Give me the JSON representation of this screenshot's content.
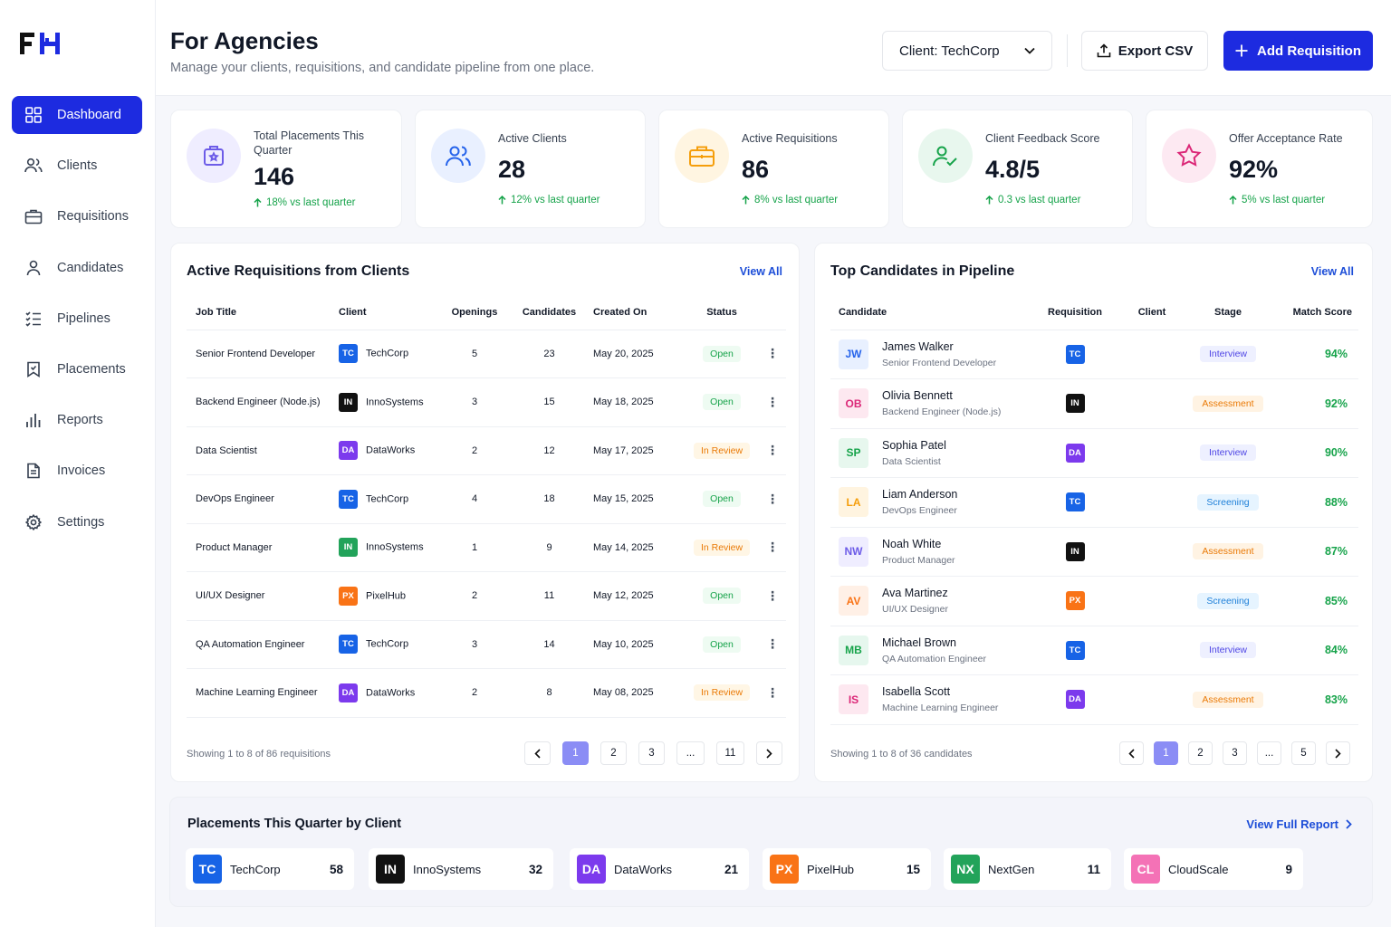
{
  "app": {
    "logo": "FH"
  },
  "sidebar": {
    "items": [
      {
        "label": "Dashboard",
        "icon": "grid-icon",
        "active": true
      },
      {
        "label": "Clients",
        "icon": "users-icon"
      },
      {
        "label": "Requisitions",
        "icon": "briefcase-icon"
      },
      {
        "label": "Candidates",
        "icon": "user-icon"
      },
      {
        "label": "Pipelines",
        "icon": "list-check-icon"
      },
      {
        "label": "Placements",
        "icon": "bookmark-icon"
      },
      {
        "label": "Reports",
        "icon": "bar-chart-icon"
      },
      {
        "label": "Invoices",
        "icon": "document-icon"
      },
      {
        "label": "Settings",
        "icon": "gear-icon"
      }
    ]
  },
  "header": {
    "title": "For Agencies",
    "subtitle": "Manage your clients, requisitions, and candidate pipeline from one place.",
    "client_select": "Client: TechCorp",
    "export_label": "Export CSV",
    "add_label": "Add Requisition"
  },
  "stats": [
    {
      "label": "Total Placements This Quarter",
      "value": "146",
      "trend": "18% vs last quarter",
      "color": "#6d5ce8"
    },
    {
      "label": "Active Clients",
      "value": "28",
      "trend": "12% vs last quarter",
      "color": "#2563eb"
    },
    {
      "label": "Active Requisitions",
      "value": "86",
      "trend": "8% vs last quarter",
      "color": "#f59e0b"
    },
    {
      "label": "Client Feedback Score",
      "value": "4.8/5",
      "trend": "0.3 vs last quarter",
      "color": "#16a34a"
    },
    {
      "label": "Offer Acceptance Rate",
      "value": "92%",
      "trend": "5% vs last quarter",
      "color": "#db2777"
    }
  ],
  "requisitions": {
    "title": "Active Requisitions from Clients",
    "view_all": "View All",
    "columns": [
      "Job Title",
      "Client",
      "Openings",
      "Candidates",
      "Created On",
      "Status"
    ],
    "rows": [
      {
        "title": "Senior Frontend Developer",
        "badge": "TC",
        "client": "TechCorp",
        "openings": "5",
        "candidates": "23",
        "created": "May 20, 2025",
        "status": "Open"
      },
      {
        "title": "Backend Engineer (Node.js)",
        "badge": "IN",
        "client": "InnoSystems",
        "openings": "3",
        "candidates": "15",
        "created": "May 18, 2025",
        "status": "Open"
      },
      {
        "title": "Data Scientist",
        "badge": "DA",
        "client": "DataWorks",
        "openings": "2",
        "candidates": "12",
        "created": "May 17, 2025",
        "status": "In Review"
      },
      {
        "title": "DevOps Engineer",
        "badge": "TC",
        "client": "TechCorp",
        "openings": "4",
        "candidates": "18",
        "created": "May 15, 2025",
        "status": "Open"
      },
      {
        "title": "Product Manager",
        "badge": "IN",
        "client": "InnoSystems",
        "openings": "1",
        "candidates": "9",
        "created": "May 14, 2025",
        "status": "In Review"
      },
      {
        "title": "UI/UX Designer",
        "badge": "PX",
        "client": "PixelHub",
        "openings": "2",
        "candidates": "11",
        "created": "May 12, 2025",
        "status": "Open"
      },
      {
        "title": "QA Automation Engineer",
        "badge": "TC",
        "client": "TechCorp",
        "openings": "3",
        "candidates": "14",
        "created": "May 10, 2025",
        "status": "Open"
      },
      {
        "title": "Machine Learning Engineer",
        "badge": "DA",
        "client": "DataWorks",
        "openings": "2",
        "candidates": "8",
        "created": "May 08, 2025",
        "status": "In Review"
      }
    ],
    "footer": "Showing 1 to 8 of 86 requisitions",
    "pages": [
      "1",
      "2",
      "3",
      "...",
      "11"
    ]
  },
  "candidates": {
    "title": "Top Candidates in Pipeline",
    "view_all": "View All",
    "columns": [
      "Candidate",
      "Requisition",
      "Client",
      "Stage",
      "Match Score"
    ],
    "rows": [
      {
        "initials": "JW",
        "name": "James Walker",
        "role": "Senior Frontend Developer",
        "badge": "TC",
        "stage": "Interview",
        "score": "94%"
      },
      {
        "initials": "OB",
        "name": "Olivia Bennett",
        "role": "Backend Engineer (Node.js)",
        "badge": "IN",
        "stage": "Assessment",
        "score": "92%"
      },
      {
        "initials": "SP",
        "name": "Sophia Patel",
        "role": "Data Scientist",
        "badge": "DA",
        "stage": "Interview",
        "score": "90%"
      },
      {
        "initials": "LA",
        "name": "Liam Anderson",
        "role": "DevOps Engineer",
        "badge": "TC",
        "stage": "Screening",
        "score": "88%"
      },
      {
        "initials": "NW",
        "name": "Noah White",
        "role": "Product Manager",
        "badge": "IN",
        "stage": "Assessment",
        "score": "87%"
      },
      {
        "initials": "AV",
        "name": "Ava Martinez",
        "role": "UI/UX Designer",
        "badge": "PX",
        "stage": "Screening",
        "score": "85%"
      },
      {
        "initials": "MB",
        "name": "Michael Brown",
        "role": "QA Automation Engineer",
        "badge": "TC",
        "stage": "Interview",
        "score": "84%"
      },
      {
        "initials": "IS",
        "name": "Isabella Scott",
        "role": "Machine Learning Engineer",
        "badge": "DA",
        "stage": "Assessment",
        "score": "83%"
      }
    ],
    "footer": "Showing 1 to 8 of 36 candidates",
    "pages": [
      "1",
      "2",
      "3",
      "...",
      "5"
    ]
  },
  "placements": {
    "title": "Placements This Quarter by Client",
    "view_report": "View Full Report",
    "items": [
      {
        "badge": "TC",
        "name": "TechCorp",
        "count": "58",
        "color": "#1763e6"
      },
      {
        "badge": "IN",
        "name": "InnoSystems",
        "count": "32",
        "color": "#111111"
      },
      {
        "badge": "DA",
        "name": "DataWorks",
        "count": "21",
        "color": "#7c3aed"
      },
      {
        "badge": "PX",
        "name": "PixelHub",
        "count": "15",
        "color": "#f97316"
      },
      {
        "badge": "NX",
        "name": "NextGen",
        "count": "11",
        "color": "#22a35a"
      },
      {
        "badge": "CL",
        "name": "CloudScale",
        "count": "9",
        "color": "#f472b6"
      }
    ]
  },
  "colors": {
    "accent": "#1d2be0",
    "TC": "#1763e6",
    "IN": "#111111",
    "DA": "#7c3aed",
    "PX": "#f97316",
    "req_IN": "#22a35a"
  }
}
